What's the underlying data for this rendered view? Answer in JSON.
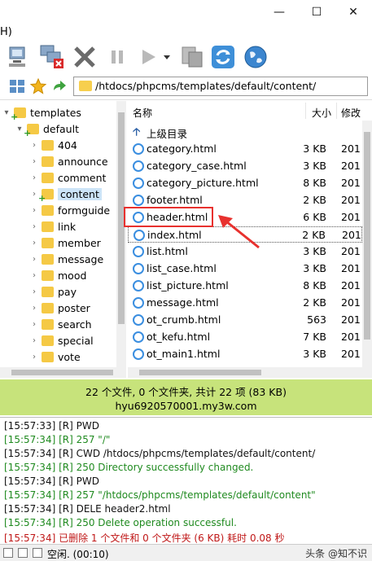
{
  "menu": {
    "help_label": "H)"
  },
  "address": {
    "path": "/htdocs/phpcms/templates/default/content/"
  },
  "tree": {
    "root": "templates",
    "child": "default",
    "folders": [
      "404",
      "announce",
      "comment",
      "content",
      "formguide",
      "link",
      "member",
      "message",
      "mood",
      "pay",
      "poster",
      "search",
      "special",
      "vote"
    ],
    "selected": "content"
  },
  "list": {
    "columns": {
      "name": "名称",
      "size": "大小",
      "modified": "修改"
    },
    "parent_label": "上级目录",
    "files": [
      {
        "name": "category.html",
        "size": "3 KB",
        "date": "201"
      },
      {
        "name": "category_case.html",
        "size": "3 KB",
        "date": "201"
      },
      {
        "name": "category_picture.html",
        "size": "8 KB",
        "date": "201"
      },
      {
        "name": "footer.html",
        "size": "2 KB",
        "date": "201"
      },
      {
        "name": "header.html",
        "size": "6 KB",
        "date": "201"
      },
      {
        "name": "index.html",
        "size": "2 KB",
        "date": "201"
      },
      {
        "name": "list.html",
        "size": "3 KB",
        "date": "201"
      },
      {
        "name": "list_case.html",
        "size": "3 KB",
        "date": "201"
      },
      {
        "name": "list_picture.html",
        "size": "8 KB",
        "date": "201"
      },
      {
        "name": "message.html",
        "size": "2 KB",
        "date": "201"
      },
      {
        "name": "ot_crumb.html",
        "size": "563",
        "date": "201"
      },
      {
        "name": "ot_kefu.html",
        "size": "7 KB",
        "date": "201"
      },
      {
        "name": "ot_main1.html",
        "size": "3 KB",
        "date": "201"
      }
    ]
  },
  "summary": {
    "counts": "22 个文件, 0 个文件夹, 共计 22 项 (83 KB)",
    "host": "hyu6920570001.my3w.com"
  },
  "log": [
    {
      "text": "[15:57:33] [R] PWD",
      "tone": "black"
    },
    {
      "text": "[15:57:34] [R] 257 \"/\"",
      "tone": "green"
    },
    {
      "text": "[15:57:34] [R] CWD /htdocs/phpcms/templates/default/content/",
      "tone": "black"
    },
    {
      "text": "[15:57:34] [R] 250 Directory successfully changed.",
      "tone": "green"
    },
    {
      "text": "[15:57:34] [R] PWD",
      "tone": "black"
    },
    {
      "text": "[15:57:34] [R] 257 \"/htdocs/phpcms/templates/default/content\"",
      "tone": "green"
    },
    {
      "text": "[15:57:34] [R] DELE header2.html",
      "tone": "black"
    },
    {
      "text": "[15:57:34] [R] 250 Delete operation successful.",
      "tone": "green"
    },
    {
      "text": "[15:57:34] 已删除 1 个文件和 0 个文件夹 (6 KB) 耗时 0.08 秒",
      "tone": "red"
    }
  ],
  "statusbar": {
    "text": "空闲. (00:10)",
    "watermark": "头条 @知不识"
  },
  "colors": {
    "summary_bg": "#c7e37b",
    "highlight": "#e8312e",
    "log_green": "#1f8a1f",
    "log_red": "#c01818"
  }
}
